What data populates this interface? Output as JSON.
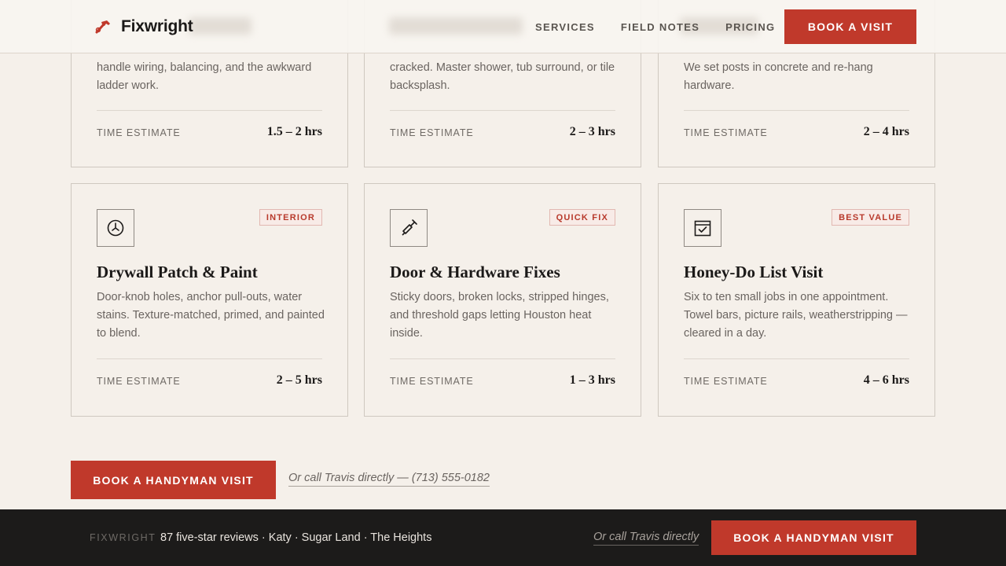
{
  "header": {
    "brand_name": "Fixwright",
    "nav": [
      "SERVICES",
      "FIELD NOTES",
      "PRICING"
    ],
    "cta_label": "BOOK A VISIT"
  },
  "cards_top": [
    {
      "desc": "handle wiring, balancing, and the awkward ladder work.",
      "est_label": "TIME ESTIMATE",
      "est_value": "1.5 – 2 hrs"
    },
    {
      "desc": "cracked. Master shower, tub surround, or tile backsplash.",
      "est_label": "TIME ESTIMATE",
      "est_value": "2 – 3 hrs"
    },
    {
      "desc": "We set posts in concrete and re-hang hardware.",
      "est_label": "TIME ESTIMATE",
      "est_value": "2 – 4 hrs"
    }
  ],
  "cards": [
    {
      "icon": "drywall-icon",
      "badge": "INTERIOR",
      "title": "Drywall Patch & Paint",
      "desc": "Door-knob holes, anchor pull-outs, water stains. Texture-matched, primed, and painted to blend.",
      "est_label": "TIME ESTIMATE",
      "est_value": "2 – 5 hrs"
    },
    {
      "icon": "screwdriver-icon",
      "badge": "QUICK FIX",
      "title": "Door & Hardware Fixes",
      "desc": "Sticky doors, broken locks, stripped hinges, and threshold gaps letting Houston heat inside.",
      "est_label": "TIME ESTIMATE",
      "est_value": "1 – 3 hrs"
    },
    {
      "icon": "calendar-check-icon",
      "badge": "BEST VALUE",
      "title": "Honey-Do List Visit",
      "desc": "Six to ten small jobs in one appointment. Towel bars, picture rails, weatherstripping — cleared in a day.",
      "est_label": "TIME ESTIMATE",
      "est_value": "4 – 6 hrs"
    }
  ],
  "cta": {
    "button_label": "BOOK A HANDYMAN VISIT",
    "call_text": "Or call Travis directly — (713) 555-0182"
  },
  "footer": {
    "brand": "FIXWRIGHT",
    "reviews": "87 five-star reviews · Katy · Sugar Land · The Heights",
    "call_text": "Or call Travis directly",
    "button_label": "BOOK A HANDYMAN VISIT"
  },
  "colors": {
    "accent": "#c0392b",
    "background": "#f5f0ea",
    "footer_bg": "#1c1b1a"
  }
}
